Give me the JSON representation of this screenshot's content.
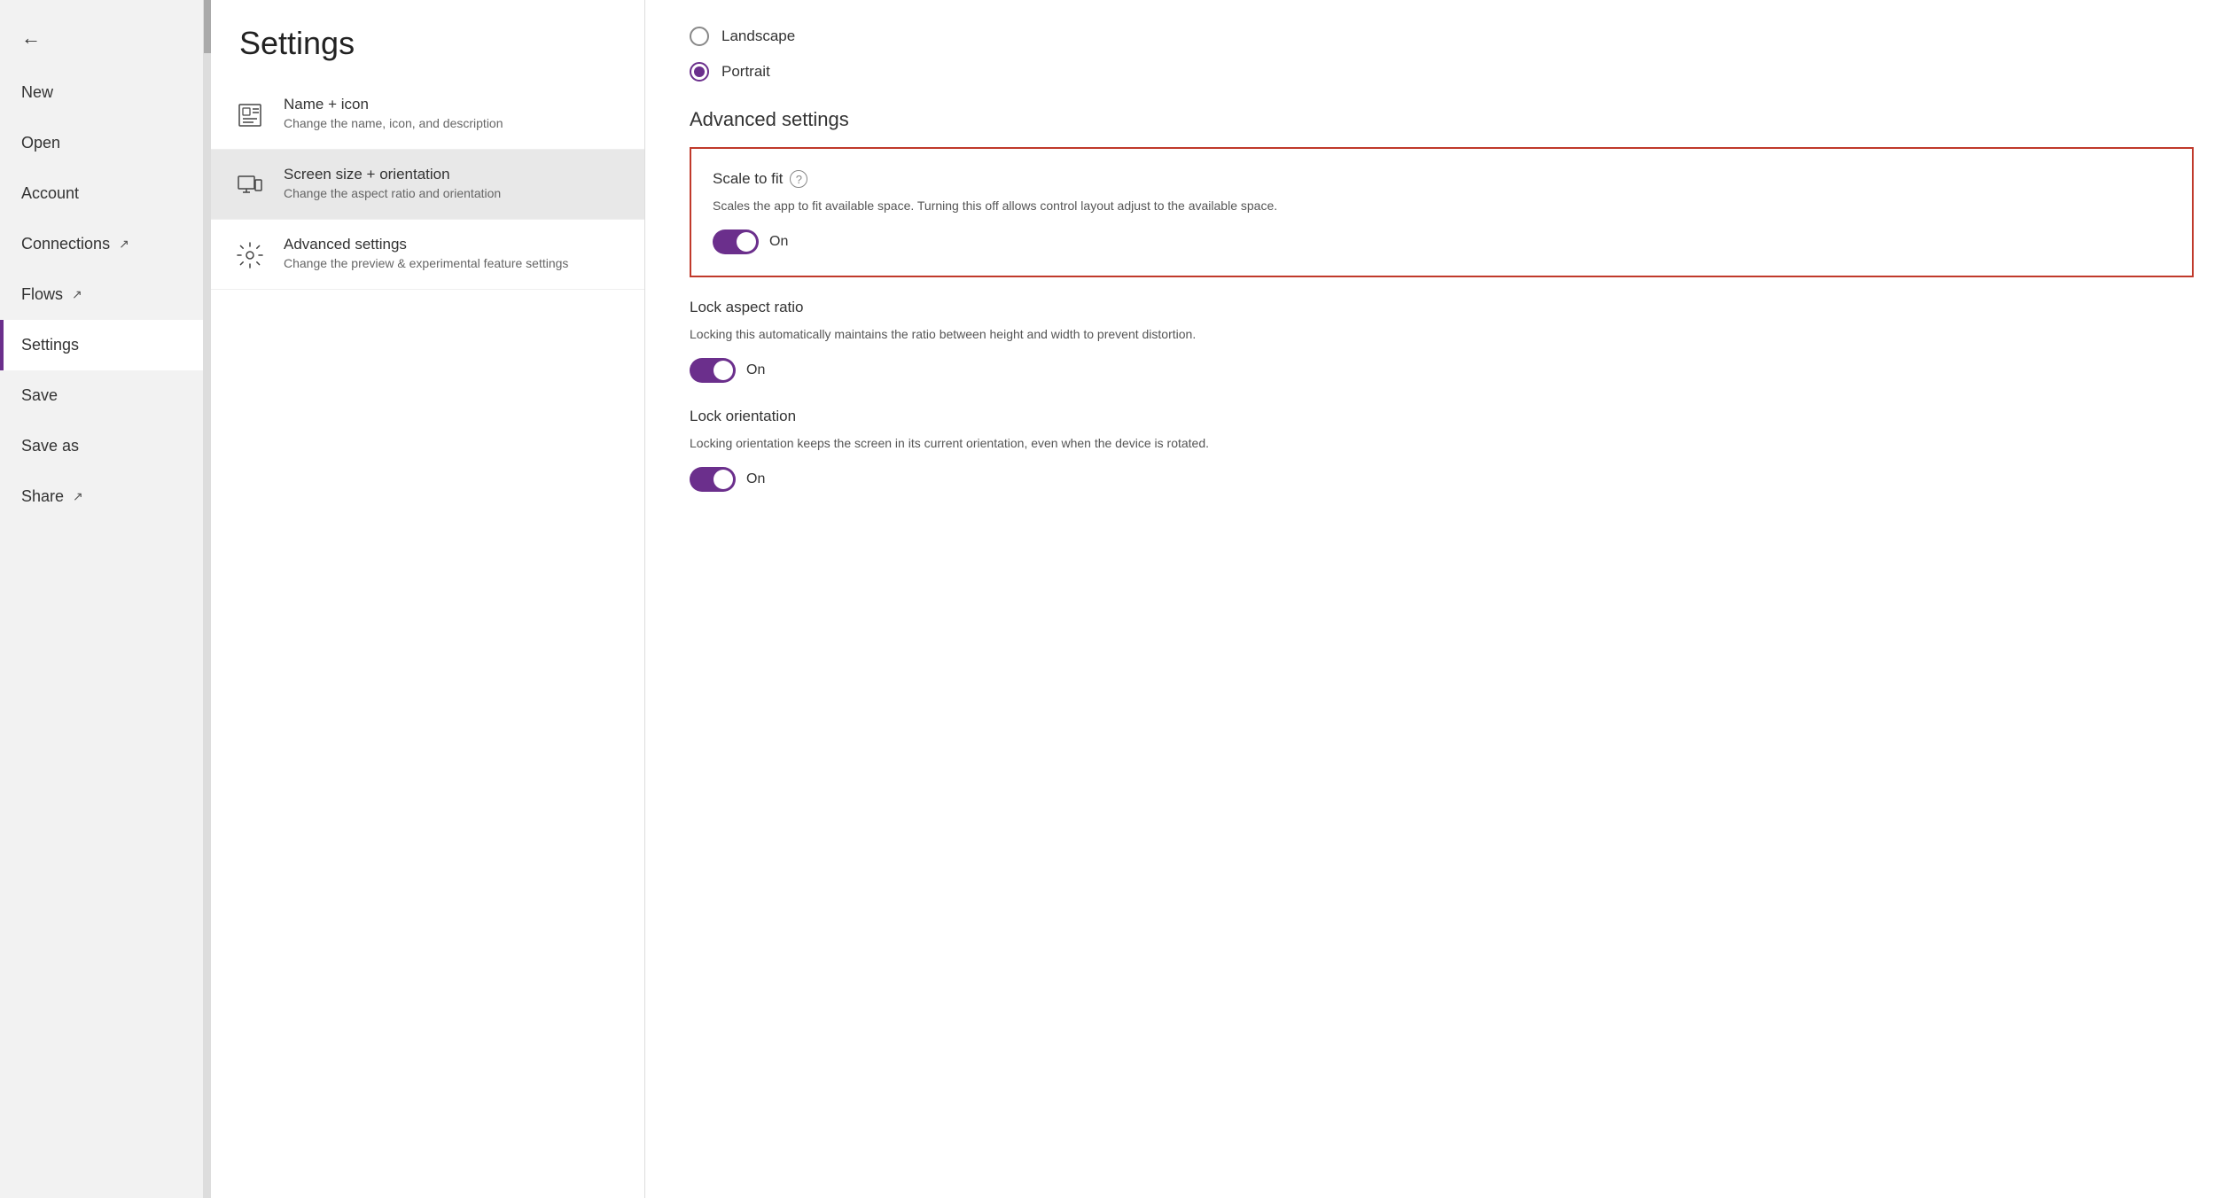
{
  "sidebar": {
    "back_label": "←",
    "items": [
      {
        "id": "new",
        "label": "New",
        "has_external": false,
        "active": false
      },
      {
        "id": "open",
        "label": "Open",
        "has_external": false,
        "active": false
      },
      {
        "id": "account",
        "label": "Account",
        "has_external": false,
        "active": false
      },
      {
        "id": "connections",
        "label": "Connections",
        "has_external": true,
        "active": false
      },
      {
        "id": "flows",
        "label": "Flows",
        "has_external": true,
        "active": false
      },
      {
        "id": "settings",
        "label": "Settings",
        "has_external": false,
        "active": true
      },
      {
        "id": "save",
        "label": "Save",
        "has_external": false,
        "active": false
      },
      {
        "id": "save-as",
        "label": "Save as",
        "has_external": false,
        "active": false
      },
      {
        "id": "share",
        "label": "Share",
        "has_external": true,
        "active": false
      }
    ]
  },
  "settings": {
    "title": "Settings",
    "menu_items": [
      {
        "id": "name-icon",
        "label": "Name + icon",
        "desc": "Change the name, icon, and description",
        "selected": false
      },
      {
        "id": "screen-size",
        "label": "Screen size + orientation",
        "desc": "Change the aspect ratio and orientation",
        "selected": true
      },
      {
        "id": "advanced",
        "label": "Advanced settings",
        "desc": "Change the preview & experimental feature settings",
        "selected": false
      }
    ]
  },
  "content": {
    "orientation": {
      "landscape_label": "Landscape",
      "portrait_label": "Portrait",
      "selected": "portrait"
    },
    "advanced_title": "Advanced settings",
    "scale_to_fit": {
      "title": "Scale to fit",
      "desc": "Scales the app to fit available space. Turning this off allows control layout adjust to the available space.",
      "toggle": "On"
    },
    "lock_aspect": {
      "title": "Lock aspect ratio",
      "desc": "Locking this automatically maintains the ratio between height and width to prevent distortion.",
      "toggle": "On"
    },
    "lock_orientation": {
      "title": "Lock orientation",
      "desc": "Locking orientation keeps the screen in its current orientation, even when the device is rotated.",
      "toggle": "On"
    }
  }
}
